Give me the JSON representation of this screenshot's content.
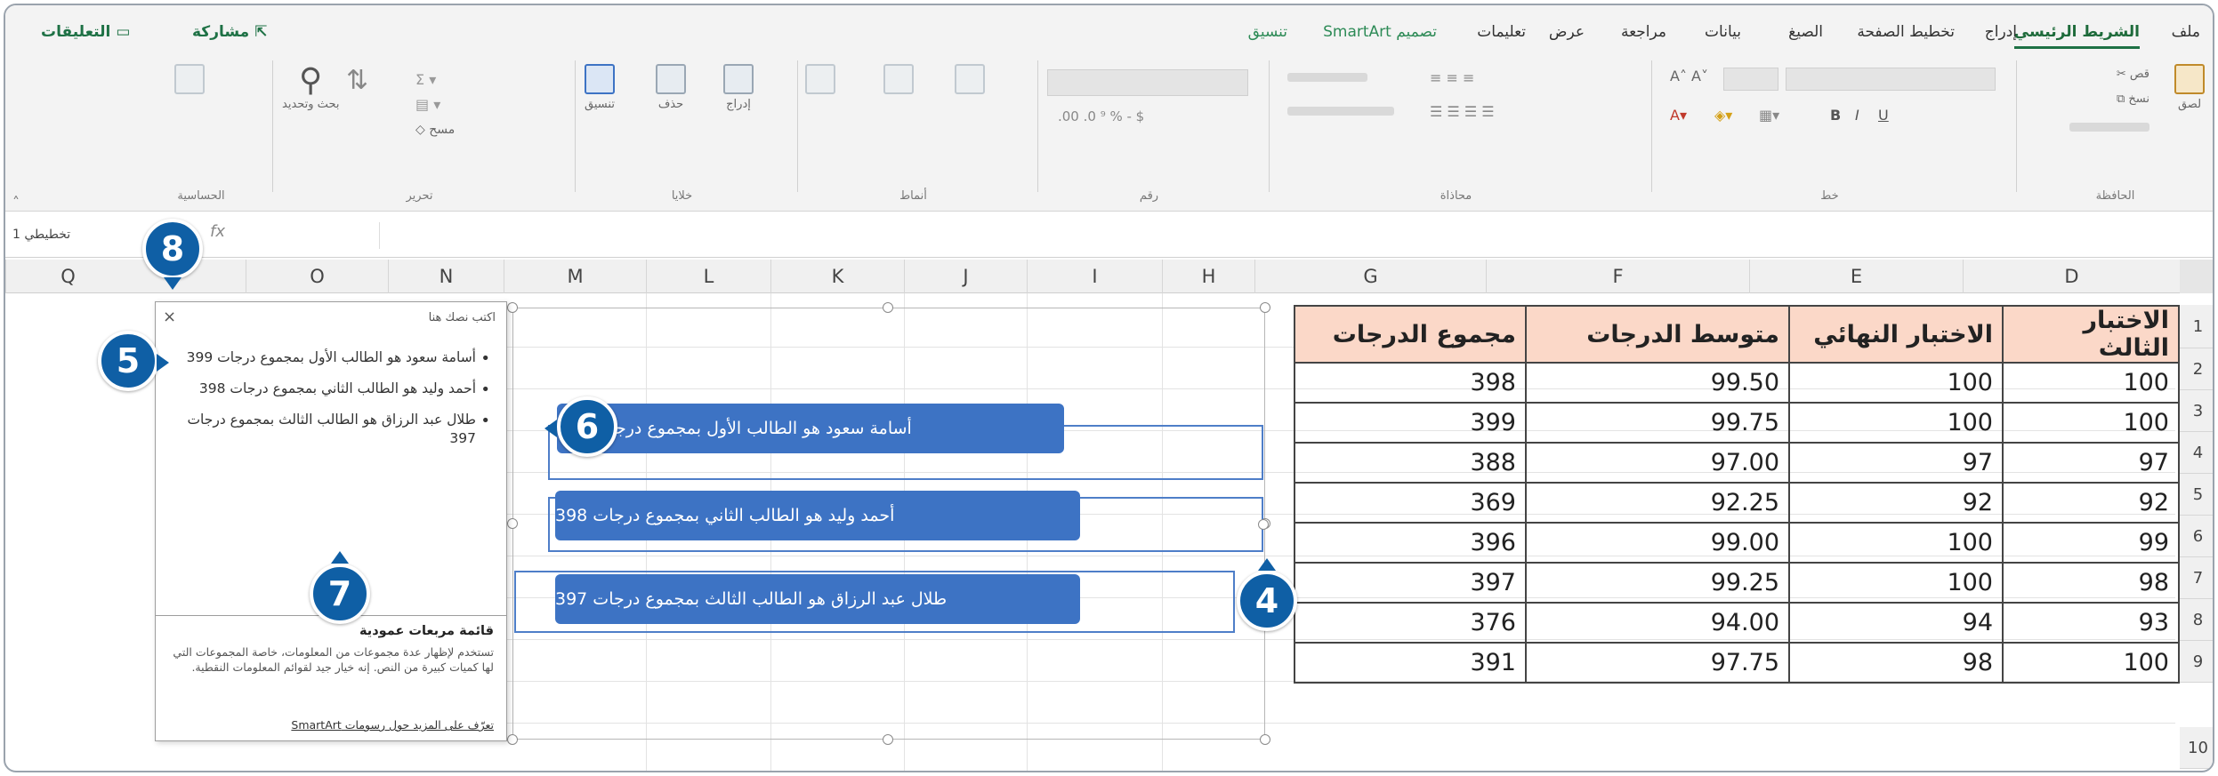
{
  "ribbon": {
    "tabs": [
      "ملف",
      "الشريط الرئيسي",
      "إدراج",
      "تخطيط الصفحة",
      "الصيغ",
      "بيانات",
      "مراجعة",
      "عرض",
      "تعليمات",
      "تصميم SmartArt",
      "تنسيق"
    ],
    "active_tab": "الشريط الرئيسي",
    "share_label": "مشاركة",
    "comments_label": "التعليقات",
    "groups": {
      "clipboard": "الحافظة",
      "font": "خط",
      "alignment": "محاذاة",
      "number": "رقم",
      "styles": "أنماط",
      "cells": "خلايا",
      "editing": "تحرير",
      "sensitivity": "الحساسية"
    },
    "buttons": {
      "paste": "لصق",
      "cut": "قص",
      "copy": "نسخ",
      "insert": "إدراج",
      "delete": "حذف",
      "format": "تنسيق",
      "find_select": "بحث وتحديد",
      "clear": "مسح"
    }
  },
  "formula_bar": {
    "name_box": "تخطيطي 1",
    "fx": "fx"
  },
  "columns": [
    "D",
    "E",
    "F",
    "G",
    "H",
    "I",
    "J",
    "K",
    "L",
    "M",
    "N",
    "O",
    "Q"
  ],
  "rows": [
    "1",
    "2",
    "3",
    "4",
    "5",
    "6",
    "7",
    "8",
    "9",
    "10"
  ],
  "table": {
    "headers": [
      "مجموع الدرجات",
      "متوسط الدرجات",
      "الاختبار النهائي",
      "الاختبار الثالث"
    ],
    "rows": [
      [
        "398",
        "99.50",
        "100",
        "100"
      ],
      [
        "399",
        "99.75",
        "100",
        "100"
      ],
      [
        "388",
        "97.00",
        "97",
        "97"
      ],
      [
        "369",
        "92.25",
        "92",
        "92"
      ],
      [
        "396",
        "99.00",
        "100",
        "99"
      ],
      [
        "397",
        "99.25",
        "100",
        "98"
      ],
      [
        "376",
        "94.00",
        "94",
        "93"
      ],
      [
        "391",
        "97.75",
        "98",
        "100"
      ]
    ]
  },
  "smartart": {
    "boxes": [
      "أسامة سعود هو الطالب الأول بمجموع درجات 399",
      "أحمد وليد هو الطالب الثاني بمجموع درجات 398",
      "طلال عبد الرزاق هو الطالب الثالث بمجموع درجات 397"
    ]
  },
  "text_pane": {
    "title": "اكتب نصك هنا",
    "close": "×",
    "items": [
      "أسامة سعود هو الطالب الأول بمجموع درجات 399",
      "أحمد وليد هو الطالب الثاني بمجموع درجات 398",
      "طلال عبد الرزاق هو الطالب الثالث بمجموع درجات 397"
    ],
    "desc_title": "قائمة مربعات عمودية",
    "desc": "تستخدم لإظهار عدة مجموعات من المعلومات، خاصة المجموعات التي لها كميات كبيرة من النص. إنه خيار جيد لقوائم المعلومات النقطية.",
    "link": "تعرّف على المزيد حول رسومات SmartArt"
  },
  "callouts": [
    "8",
    "5",
    "6",
    "7",
    "4"
  ],
  "colors": {
    "accent": "#1e7145",
    "smartart_fill": "#3d73c4",
    "header_fill": "#fbd8c8",
    "callout": "#0f5fa5"
  }
}
